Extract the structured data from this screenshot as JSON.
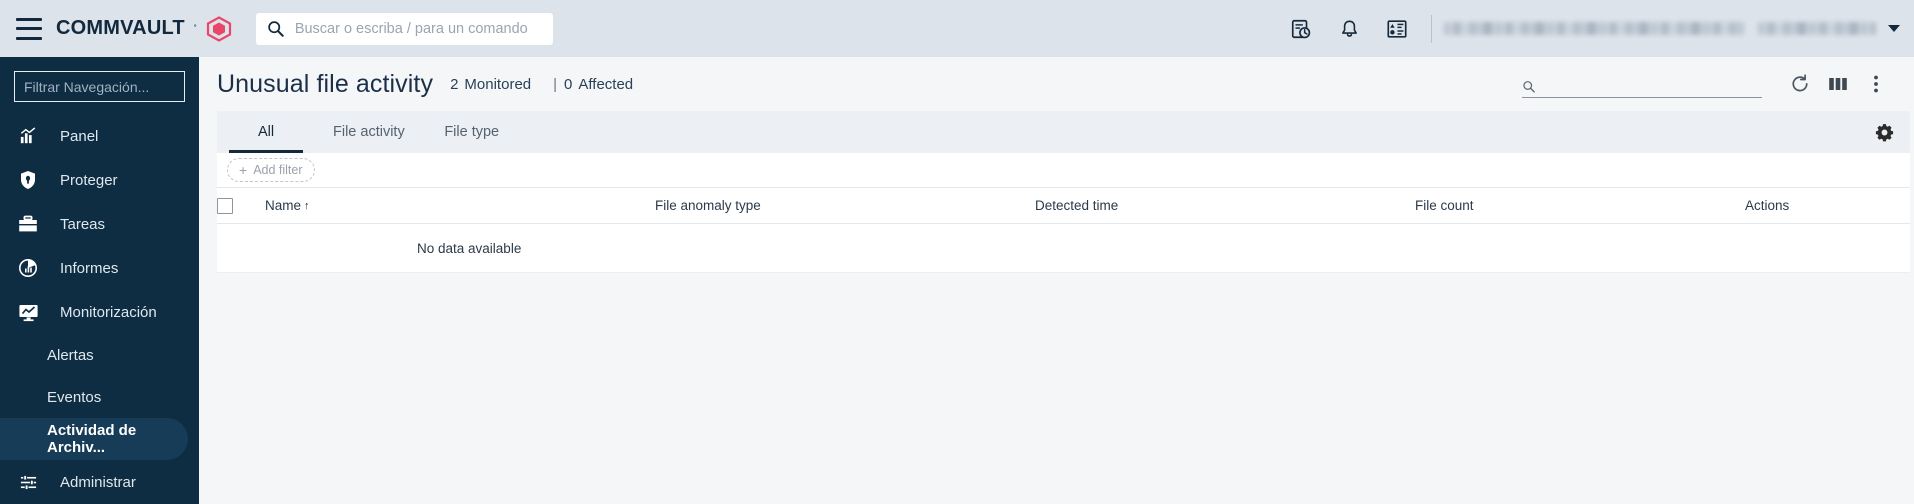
{
  "topbar": {
    "menu_icon": "hamburger-icon",
    "brand_name": "COMMVAULT",
    "brand_tm": "˚",
    "brand_mark_icon": "commvault-cube-logo",
    "search": {
      "placeholder": "Buscar o escriba / para un comando",
      "value": "",
      "icon": "search-icon"
    },
    "icons": [
      {
        "name": "clipboard-clock-icon",
        "label": "Tareas recientes"
      },
      {
        "name": "bell-icon",
        "label": "Notificaciones"
      },
      {
        "name": "alerts-panel-icon",
        "label": "Panel de eventos"
      }
    ],
    "user_name_redacted": "",
    "user_company_redacted": "",
    "caret_icon": "chevron-down-icon"
  },
  "sidebar": {
    "filter": {
      "placeholder": "Filtrar Navegación...",
      "value": ""
    },
    "items": [
      {
        "label": "Panel",
        "icon": "dashboard-chart-icon",
        "level": "top",
        "active": false
      },
      {
        "label": "Proteger",
        "icon": "shield-icon",
        "level": "top",
        "active": false
      },
      {
        "label": "Tareas",
        "icon": "briefcase-icon",
        "level": "top",
        "active": false
      },
      {
        "label": "Informes",
        "icon": "report-donut-icon",
        "level": "top",
        "active": false
      },
      {
        "label": "Monitorización",
        "icon": "monitor-chart-icon",
        "level": "top",
        "active": false
      },
      {
        "label": "Alertas",
        "icon": "",
        "level": "child",
        "active": false
      },
      {
        "label": "Eventos",
        "icon": "",
        "level": "child",
        "active": false
      },
      {
        "label": "Actividad de Archiv...",
        "icon": "",
        "level": "child",
        "active": true
      },
      {
        "label": "Administrar",
        "icon": "sliders-icon",
        "level": "top",
        "active": false
      }
    ]
  },
  "page": {
    "title": "Unusual file activity",
    "stats": [
      {
        "value": "2",
        "label": "Monitored"
      },
      {
        "value": "0",
        "label": "Affected"
      }
    ],
    "stat_separator": "|",
    "tools": {
      "search": {
        "placeholder": "",
        "value": "",
        "icon": "search-icon"
      },
      "refresh_icon": "refresh-icon",
      "columns_icon": "columns-icon",
      "more_icon": "kebab-menu-icon"
    },
    "tabs": [
      {
        "label": "All",
        "active": true
      },
      {
        "label": "File activity",
        "active": false
      },
      {
        "label": "File type",
        "active": false
      }
    ],
    "tabs_settings_icon": "gear-icon",
    "add_filter": {
      "label": "Add filter",
      "icon": "plus-icon"
    },
    "table": {
      "select_all_checkbox": "select-all-checkbox",
      "columns": [
        {
          "label": "Name",
          "sorted": true,
          "sort_icon": "↑"
        },
        {
          "label": "File anomaly type",
          "sorted": false,
          "sort_icon": ""
        },
        {
          "label": "Detected time",
          "sorted": false,
          "sort_icon": ""
        },
        {
          "label": "File count",
          "sorted": false,
          "sort_icon": ""
        },
        {
          "label": "Actions",
          "sorted": false,
          "sort_icon": ""
        }
      ],
      "rows": [],
      "empty_message": "No data available"
    }
  },
  "colors": {
    "topbar_bg": "#dde3ea",
    "sidebar_bg": "#0e2c42",
    "sidebar_active_bg": "#163c58",
    "brand_red": "#e8476a",
    "page_bg": "#f5f6f8",
    "tabs_bg": "#eceff4",
    "text_dark": "#15293d"
  }
}
